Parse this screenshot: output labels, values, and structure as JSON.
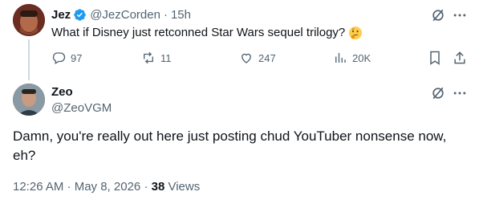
{
  "parent": {
    "name": "Jez",
    "handle": "@JezCorden",
    "time": "15h",
    "text": "What if Disney just retconned Star Wars sequel trilogy?",
    "emoji": "thinking-face",
    "stats": {
      "replies": "97",
      "reposts": "11",
      "likes": "247",
      "views": "20K"
    }
  },
  "reply": {
    "name": "Zeo",
    "handle": "@ZeoVGM",
    "text": "Damn, you're really out here just posting chud YouTuber nonsense now, eh?",
    "timestamp": "12:26 AM · May 8, 2026",
    "views_count": "38",
    "views_label": "Views"
  },
  "colors": {
    "verified": "#1d9bf0",
    "muted": "#536471",
    "thread_line": "#cfd9de"
  }
}
